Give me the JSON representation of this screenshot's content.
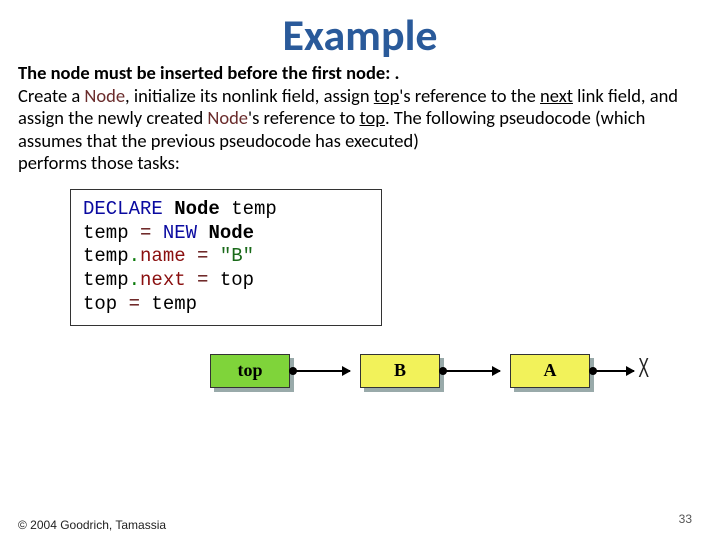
{
  "title": "Example",
  "para": {
    "lead": "The node must be inserted before the first node: .",
    "t1": "Create a ",
    "noun1": "Node",
    "t2": ", initialize its nonlink field, assign ",
    "top1": "top",
    "t3": "'s reference to the ",
    "next1": "next",
    "t4": " link field,  and assign the newly created ",
    "noun2": "Node",
    "t5": "'s reference to ",
    "top2": "top",
    "t6": ". The following pseudocode (which assumes that the previous pseudocode has executed)",
    "t7": " performs those tasks:"
  },
  "code": {
    "l1a": "DECLARE ",
    "l1b": "Node",
    "l1c": " temp",
    "l2a": "temp ",
    "l2b": "=",
    "l2c": " NEW ",
    "l2d": "Node",
    "l3a": "temp",
    "l3b": ".",
    "l3c": "name ",
    "l3d": "=",
    "l3e": " \"B\"",
    "l4a": "temp",
    "l4b": ".",
    "l4c": "next ",
    "l4d": "=",
    "l4e": " top",
    "l5a": " top ",
    "l5b": "=",
    "l5c": " temp"
  },
  "diagram": {
    "top": "top",
    "b": "B",
    "a": "A",
    "x": "X"
  },
  "footer": {
    "copyright": "© 2004 Goodrich, Tamassia",
    "page": "33"
  }
}
